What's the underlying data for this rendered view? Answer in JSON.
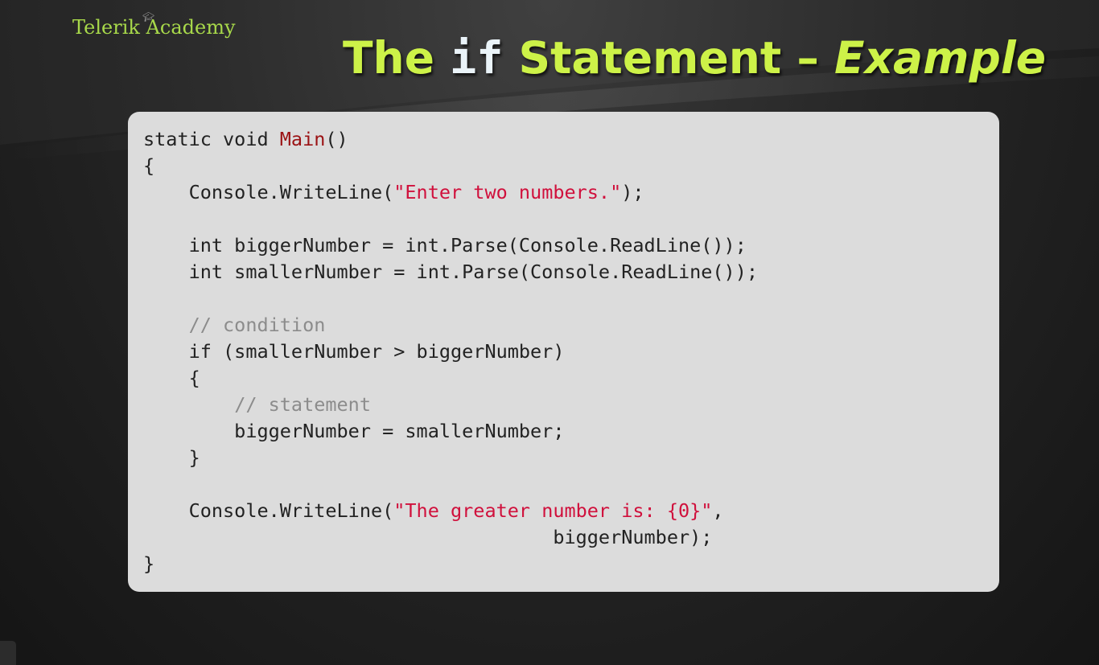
{
  "slide": {
    "logo_text": "Telerik Academy",
    "title": {
      "prefix": "The ",
      "keyword": "if",
      "middle": " Statement",
      "dash": " – ",
      "emphasis": "Example"
    }
  },
  "code": {
    "lines": [
      [
        {
          "t": "static void ",
          "k": "plain"
        },
        {
          "t": "Main",
          "k": "method"
        },
        {
          "t": "()",
          "k": "plain"
        }
      ],
      [
        {
          "t": "{",
          "k": "plain"
        }
      ],
      [
        {
          "t": "    Console.WriteLine(",
          "k": "plain"
        },
        {
          "t": "\"Enter two numbers.\"",
          "k": "string"
        },
        {
          "t": ");",
          "k": "plain"
        }
      ],
      [
        {
          "t": "",
          "k": "plain"
        }
      ],
      [
        {
          "t": "    int biggerNumber = int.Parse(Console.ReadLine());",
          "k": "plain"
        }
      ],
      [
        {
          "t": "    int smallerNumber = int.Parse(Console.ReadLine());",
          "k": "plain"
        }
      ],
      [
        {
          "t": "",
          "k": "plain"
        }
      ],
      [
        {
          "t": "    ",
          "k": "plain"
        },
        {
          "t": "// condition",
          "k": "comment"
        }
      ],
      [
        {
          "t": "    if (smallerNumber > biggerNumber)",
          "k": "plain"
        }
      ],
      [
        {
          "t": "    {",
          "k": "plain"
        }
      ],
      [
        {
          "t": "        ",
          "k": "plain"
        },
        {
          "t": "// statement",
          "k": "comment"
        }
      ],
      [
        {
          "t": "        biggerNumber = smallerNumber;",
          "k": "plain"
        }
      ],
      [
        {
          "t": "    }",
          "k": "plain"
        }
      ],
      [
        {
          "t": "",
          "k": "plain"
        }
      ],
      [
        {
          "t": "    Console.WriteLine(",
          "k": "plain"
        },
        {
          "t": "\"The greater number is: {0}\"",
          "k": "string"
        },
        {
          "t": ",",
          "k": "plain"
        }
      ],
      [
        {
          "t": "                                    biggerNumber);",
          "k": "plain"
        }
      ],
      [
        {
          "t": "}",
          "k": "plain"
        }
      ]
    ]
  },
  "colors": {
    "title_green": "#cdf248",
    "keyword_white": "#eaf3f8",
    "method_red": "#9b1214",
    "string_red": "#d0103c",
    "comment_gray": "#8c8c8c",
    "code_background": "#dcdcdc"
  }
}
